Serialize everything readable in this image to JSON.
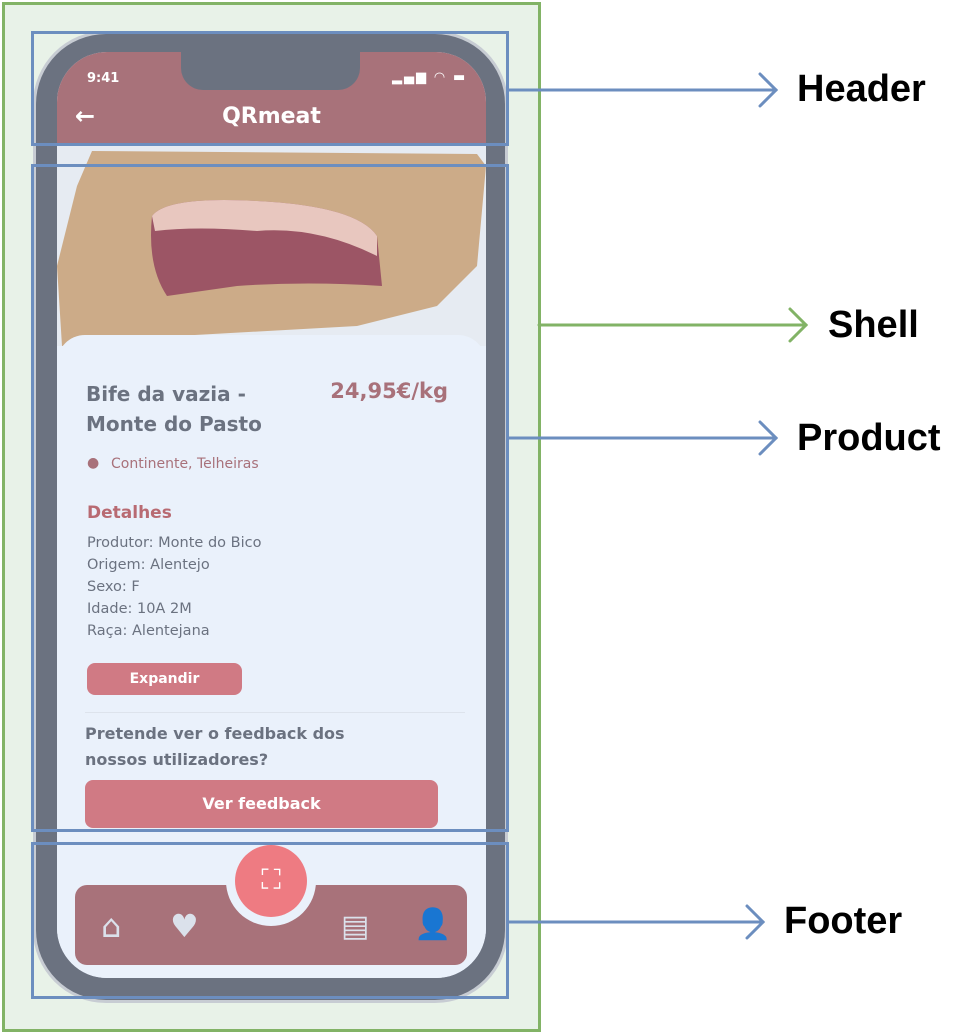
{
  "app": {
    "time": "9:41",
    "title": "QRmeat"
  },
  "product": {
    "name_line1": "Bife da vazia -",
    "name_line2": "Monte do Pasto",
    "price": "24,95€/kg",
    "location": "Continente, Telheiras",
    "details_heading": "Detalhes",
    "details": [
      "Produtor: Monte do Bico",
      "Origem: Alentejo",
      "Sexo: F",
      "Idade: 10A 2M",
      "Raça: Alentejana"
    ],
    "expand_label": "Expandir",
    "feedback_question_line1": "Pretende ver o feedback dos",
    "feedback_question_line2": "nossos utilizadores?",
    "feedback_button": "Ver feedback"
  },
  "annotations": {
    "header": "Header",
    "shell": "Shell",
    "product": "Product",
    "footer": "Footer"
  },
  "colors": {
    "brand": "#a8727a",
    "accent": "#ee7b82",
    "annotation_blue": "#6c8ebf",
    "annotation_green": "#82b366"
  }
}
